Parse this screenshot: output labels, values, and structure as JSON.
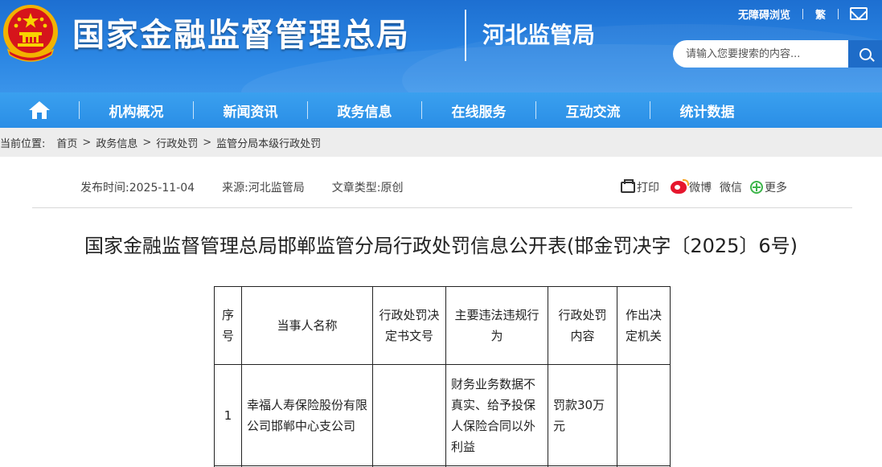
{
  "header": {
    "site_title": "国家金融监督管理总局",
    "bureau": "河北监管局",
    "top_links": [
      "无障碍浏览",
      "繁"
    ],
    "search_placeholder": "请输入您要搜索的内容..."
  },
  "nav": {
    "items": [
      "机构概况",
      "新闻资讯",
      "政务信息",
      "在线服务",
      "互动交流",
      "统计数据"
    ]
  },
  "breadcrumb": {
    "label": "当前位置:",
    "items": [
      "首页",
      "政务信息",
      "行政处罚",
      "监管分局本级行政处罚"
    ]
  },
  "meta": {
    "publish_time": "发布时间:2025-11-04",
    "source": "来源:河北监管局",
    "type": "文章类型:原创"
  },
  "share": {
    "print": "打印",
    "weibo": "微博",
    "wechat": "微信",
    "more": "更多"
  },
  "article": {
    "title": "国家金融监督管理总局邯郸监管分局行政处罚信息公开表(邯金罚决字〔2025〕6号)"
  },
  "table": {
    "headers": [
      "序号",
      "当事人名称",
      "行政处罚决定书文号",
      "主要违法违规行为",
      "行政处罚内容",
      "作出决定机关"
    ],
    "rows": [
      {
        "no": "1",
        "party": "幸福人寿保险股份有限公司邯郸中心支公司",
        "doc_no": "",
        "violation": "财务业务数据不真实、给予投保人保险合同以外利益",
        "penalty": "罚款30万元",
        "authority": ""
      }
    ]
  },
  "colors": {
    "header_blue": "#2b86e3",
    "nav_blue": "#2a8ee6",
    "breadcrumb_bg": "#ededed"
  }
}
